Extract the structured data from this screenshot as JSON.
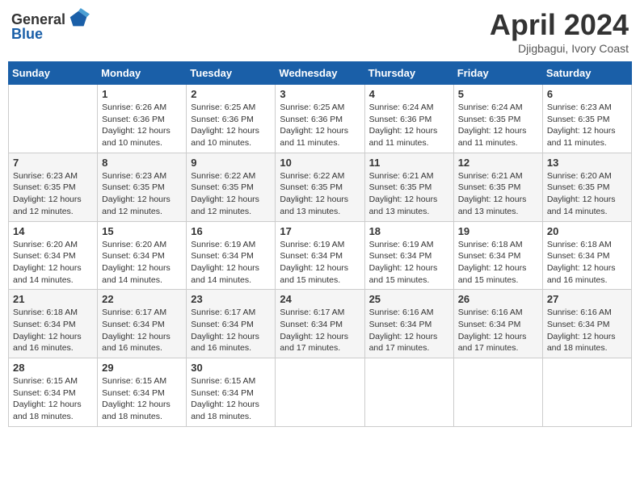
{
  "header": {
    "logo_general": "General",
    "logo_blue": "Blue",
    "month_title": "April 2024",
    "location": "Djigbagui, Ivory Coast"
  },
  "weekdays": [
    "Sunday",
    "Monday",
    "Tuesday",
    "Wednesday",
    "Thursday",
    "Friday",
    "Saturday"
  ],
  "weeks": [
    [
      {
        "day": "",
        "info": ""
      },
      {
        "day": "1",
        "info": "Sunrise: 6:26 AM\nSunset: 6:36 PM\nDaylight: 12 hours\nand 10 minutes."
      },
      {
        "day": "2",
        "info": "Sunrise: 6:25 AM\nSunset: 6:36 PM\nDaylight: 12 hours\nand 10 minutes."
      },
      {
        "day": "3",
        "info": "Sunrise: 6:25 AM\nSunset: 6:36 PM\nDaylight: 12 hours\nand 11 minutes."
      },
      {
        "day": "4",
        "info": "Sunrise: 6:24 AM\nSunset: 6:36 PM\nDaylight: 12 hours\nand 11 minutes."
      },
      {
        "day": "5",
        "info": "Sunrise: 6:24 AM\nSunset: 6:35 PM\nDaylight: 12 hours\nand 11 minutes."
      },
      {
        "day": "6",
        "info": "Sunrise: 6:23 AM\nSunset: 6:35 PM\nDaylight: 12 hours\nand 11 minutes."
      }
    ],
    [
      {
        "day": "7",
        "info": "Sunrise: 6:23 AM\nSunset: 6:35 PM\nDaylight: 12 hours\nand 12 minutes."
      },
      {
        "day": "8",
        "info": "Sunrise: 6:23 AM\nSunset: 6:35 PM\nDaylight: 12 hours\nand 12 minutes."
      },
      {
        "day": "9",
        "info": "Sunrise: 6:22 AM\nSunset: 6:35 PM\nDaylight: 12 hours\nand 12 minutes."
      },
      {
        "day": "10",
        "info": "Sunrise: 6:22 AM\nSunset: 6:35 PM\nDaylight: 12 hours\nand 13 minutes."
      },
      {
        "day": "11",
        "info": "Sunrise: 6:21 AM\nSunset: 6:35 PM\nDaylight: 12 hours\nand 13 minutes."
      },
      {
        "day": "12",
        "info": "Sunrise: 6:21 AM\nSunset: 6:35 PM\nDaylight: 12 hours\nand 13 minutes."
      },
      {
        "day": "13",
        "info": "Sunrise: 6:20 AM\nSunset: 6:35 PM\nDaylight: 12 hours\nand 14 minutes."
      }
    ],
    [
      {
        "day": "14",
        "info": "Sunrise: 6:20 AM\nSunset: 6:34 PM\nDaylight: 12 hours\nand 14 minutes."
      },
      {
        "day": "15",
        "info": "Sunrise: 6:20 AM\nSunset: 6:34 PM\nDaylight: 12 hours\nand 14 minutes."
      },
      {
        "day": "16",
        "info": "Sunrise: 6:19 AM\nSunset: 6:34 PM\nDaylight: 12 hours\nand 14 minutes."
      },
      {
        "day": "17",
        "info": "Sunrise: 6:19 AM\nSunset: 6:34 PM\nDaylight: 12 hours\nand 15 minutes."
      },
      {
        "day": "18",
        "info": "Sunrise: 6:19 AM\nSunset: 6:34 PM\nDaylight: 12 hours\nand 15 minutes."
      },
      {
        "day": "19",
        "info": "Sunrise: 6:18 AM\nSunset: 6:34 PM\nDaylight: 12 hours\nand 15 minutes."
      },
      {
        "day": "20",
        "info": "Sunrise: 6:18 AM\nSunset: 6:34 PM\nDaylight: 12 hours\nand 16 minutes."
      }
    ],
    [
      {
        "day": "21",
        "info": "Sunrise: 6:18 AM\nSunset: 6:34 PM\nDaylight: 12 hours\nand 16 minutes."
      },
      {
        "day": "22",
        "info": "Sunrise: 6:17 AM\nSunset: 6:34 PM\nDaylight: 12 hours\nand 16 minutes."
      },
      {
        "day": "23",
        "info": "Sunrise: 6:17 AM\nSunset: 6:34 PM\nDaylight: 12 hours\nand 16 minutes."
      },
      {
        "day": "24",
        "info": "Sunrise: 6:17 AM\nSunset: 6:34 PM\nDaylight: 12 hours\nand 17 minutes."
      },
      {
        "day": "25",
        "info": "Sunrise: 6:16 AM\nSunset: 6:34 PM\nDaylight: 12 hours\nand 17 minutes."
      },
      {
        "day": "26",
        "info": "Sunrise: 6:16 AM\nSunset: 6:34 PM\nDaylight: 12 hours\nand 17 minutes."
      },
      {
        "day": "27",
        "info": "Sunrise: 6:16 AM\nSunset: 6:34 PM\nDaylight: 12 hours\nand 18 minutes."
      }
    ],
    [
      {
        "day": "28",
        "info": "Sunrise: 6:15 AM\nSunset: 6:34 PM\nDaylight: 12 hours\nand 18 minutes."
      },
      {
        "day": "29",
        "info": "Sunrise: 6:15 AM\nSunset: 6:34 PM\nDaylight: 12 hours\nand 18 minutes."
      },
      {
        "day": "30",
        "info": "Sunrise: 6:15 AM\nSunset: 6:34 PM\nDaylight: 12 hours\nand 18 minutes."
      },
      {
        "day": "",
        "info": ""
      },
      {
        "day": "",
        "info": ""
      },
      {
        "day": "",
        "info": ""
      },
      {
        "day": "",
        "info": ""
      }
    ]
  ]
}
